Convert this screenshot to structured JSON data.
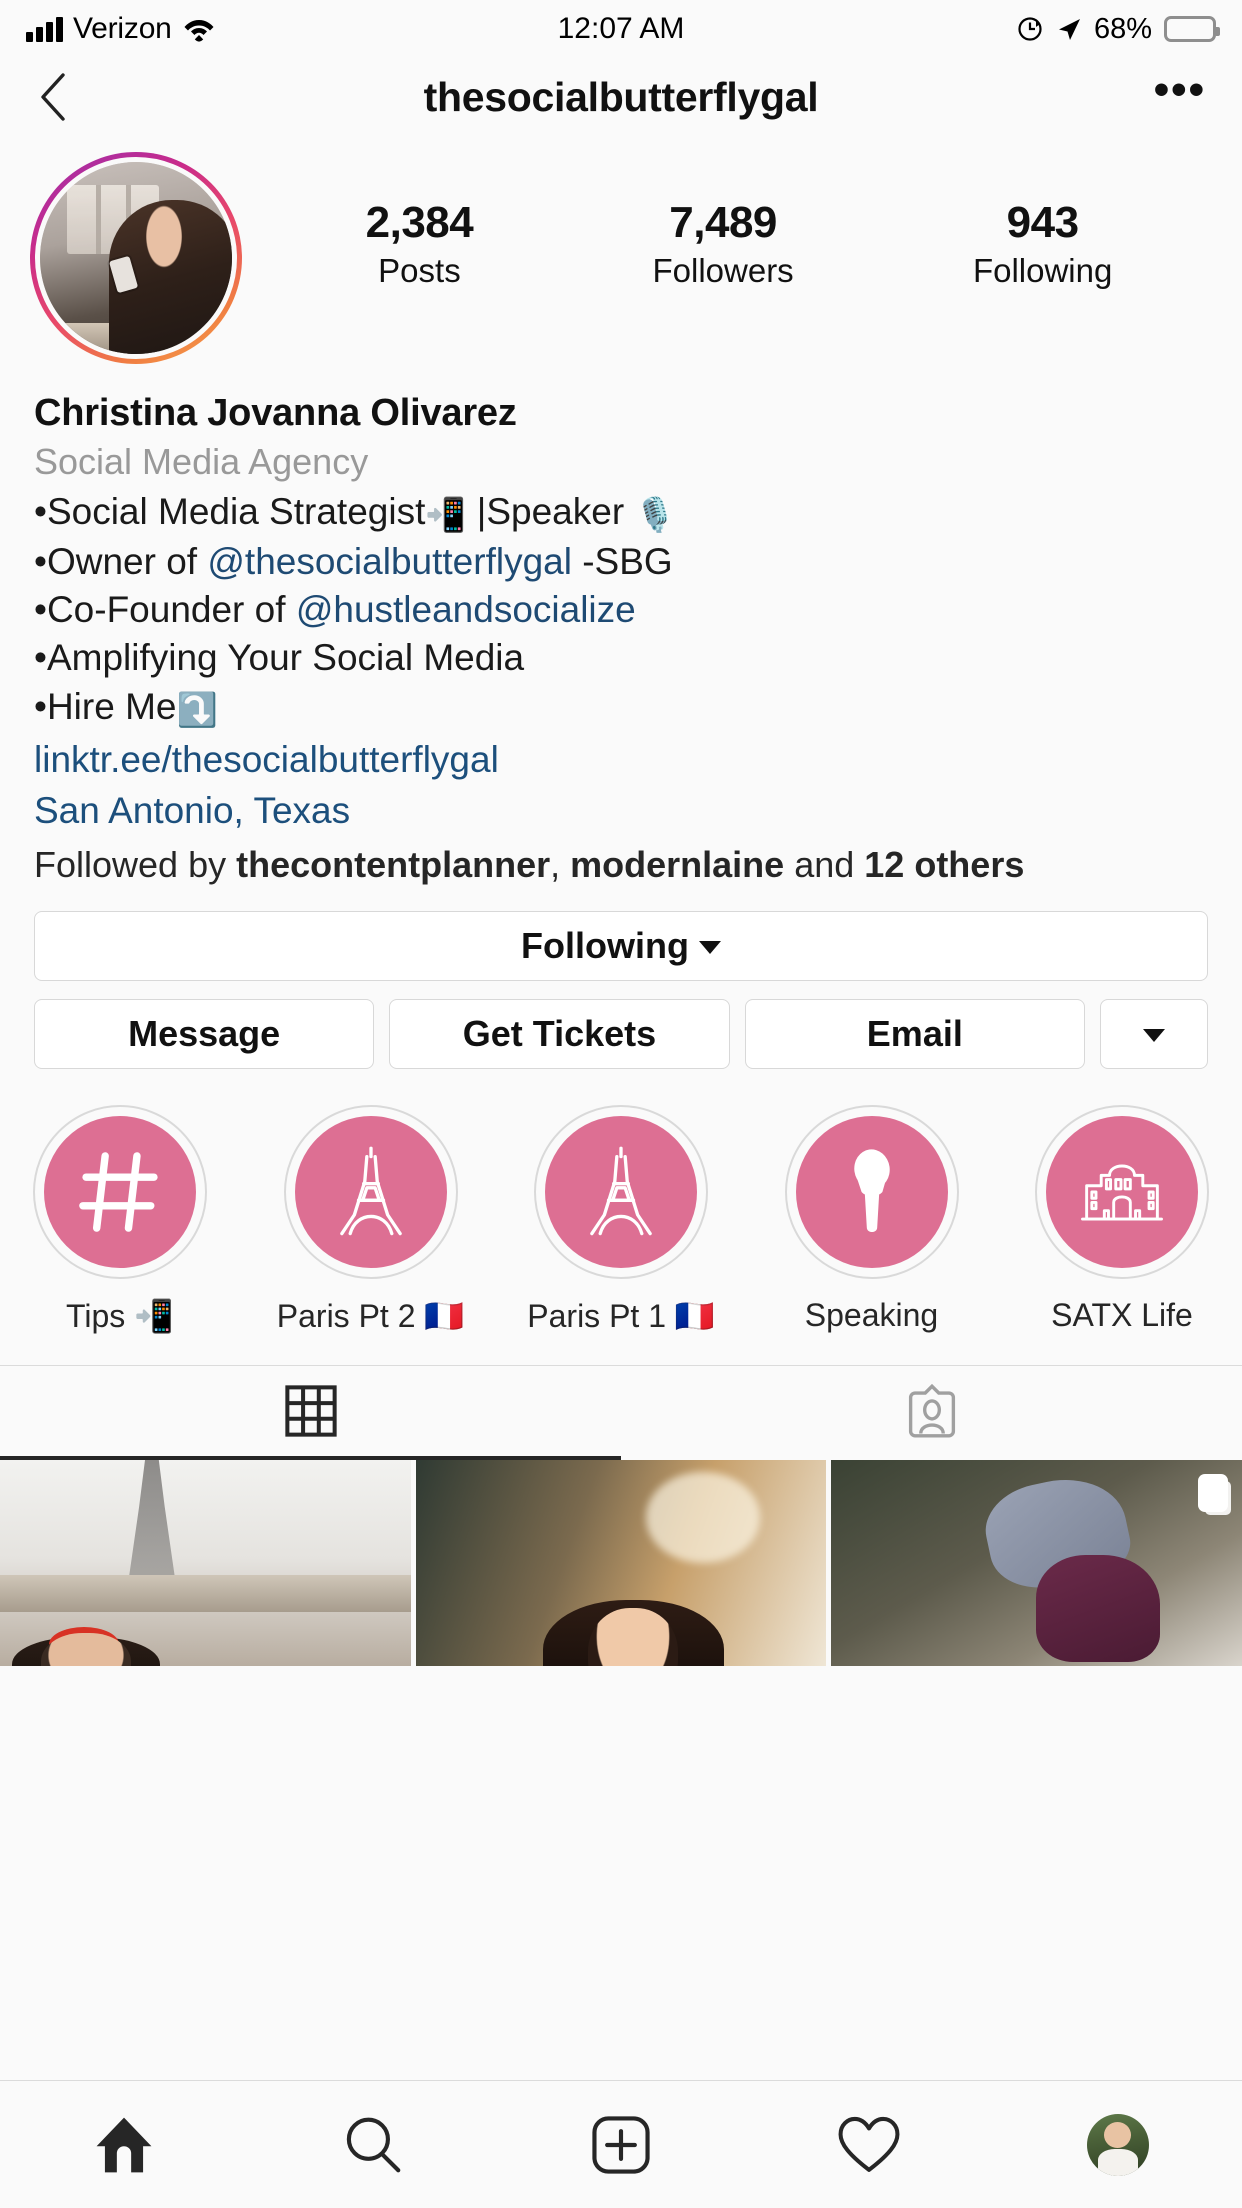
{
  "status_bar": {
    "carrier": "Verizon",
    "time": "12:07 AM",
    "battery_pct": "68%",
    "icons": [
      "signal-bars-icon",
      "wifi-icon",
      "rotation-lock-icon",
      "location-arrow-icon",
      "battery-icon"
    ]
  },
  "nav": {
    "back_icon": "back-chevron-icon",
    "title": "thesocialbutterflygal",
    "more_icon": "more-options-icon",
    "more_label": "•••"
  },
  "profile": {
    "avatar_has_story_ring": true,
    "stats": [
      {
        "value": "2,384",
        "label": "Posts"
      },
      {
        "value": "7,489",
        "label": "Followers"
      },
      {
        "value": "943",
        "label": "Following"
      }
    ],
    "full_name": "Christina Jovanna Olivarez",
    "category": "Social Media Agency",
    "bio_lines": [
      {
        "prefix": "•Social Media Strategist",
        "emoji": "📲",
        "middle": " |Speaker ",
        "emoji2": "🎙️",
        "mention": "",
        "suffix": ""
      },
      {
        "prefix": "•Owner of ",
        "emoji": "",
        "middle": "",
        "emoji2": "",
        "mention": "@thesocialbutterflygal",
        "suffix": " -SBG"
      },
      {
        "prefix": "•Co-Founder of ",
        "emoji": "",
        "middle": "",
        "emoji2": "",
        "mention": "@hustleandsocialize",
        "suffix": ""
      },
      {
        "prefix": "•Amplifying Your Social Media",
        "emoji": "",
        "middle": "",
        "emoji2": "",
        "mention": "",
        "suffix": ""
      },
      {
        "prefix": "•Hire Me",
        "emoji": "⤵️",
        "middle": "",
        "emoji2": "",
        "mention": "",
        "suffix": ""
      }
    ],
    "website": "linktr.ee/thesocialbutterflygal",
    "location": "San Antonio, Texas",
    "followed_by": {
      "prefix": "Followed by ",
      "name1": "thecontentplanner",
      "sep": ", ",
      "name2": "modernlaine",
      "mid": " and ",
      "others": "12 others"
    }
  },
  "buttons": {
    "following": "Following",
    "message": "Message",
    "get_tickets": "Get Tickets",
    "email": "Email",
    "more_caret_icon": "chevron-down-icon"
  },
  "highlights": [
    {
      "label": "Tips 📲",
      "icon": "hashtag-icon"
    },
    {
      "label": "Paris Pt 2 🇫🇷",
      "icon": "eiffel-tower-icon"
    },
    {
      "label": "Paris Pt 1 🇫🇷",
      "icon": "eiffel-tower-icon"
    },
    {
      "label": "Speaking",
      "icon": "microphone-icon"
    },
    {
      "label": "SATX Life",
      "icon": "alamo-building-icon"
    }
  ],
  "tabs": [
    {
      "name": "grid-tab",
      "icon": "grid-icon",
      "active": true
    },
    {
      "name": "tagged-tab",
      "icon": "tagged-person-icon",
      "active": false
    }
  ],
  "grid_posts": [
    {
      "alt": "woman-red-beret-eiffel-tower",
      "carousel": false
    },
    {
      "alt": "woman-smiling-cafe-portrait",
      "carousel": false
    },
    {
      "alt": "couple-dancing-street",
      "carousel": true
    }
  ],
  "bottom_nav": [
    {
      "name": "home-tab",
      "icon": "home-icon",
      "active": true
    },
    {
      "name": "search-tab",
      "icon": "search-icon",
      "active": false
    },
    {
      "name": "add-post-tab",
      "icon": "plus-square-icon",
      "active": false
    },
    {
      "name": "activity-tab",
      "icon": "heart-icon",
      "active": false
    },
    {
      "name": "profile-tab",
      "icon": "profile-avatar-icon",
      "active": false
    }
  ],
  "colors": {
    "highlight_pink": "#dd6f93",
    "link_blue": "#1c4f7c",
    "border_gray": "#dbdbdb",
    "background": "#fafafa"
  }
}
